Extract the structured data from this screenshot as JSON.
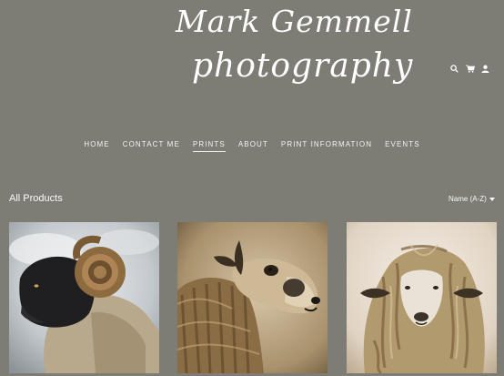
{
  "header": {
    "logo_line1": "Mark Gemmell",
    "logo_line2": "photography",
    "icons": [
      "search-icon",
      "cart-icon",
      "user-icon"
    ]
  },
  "nav": {
    "items": [
      "HOME",
      "CONTACT ME",
      "PRINTS",
      "ABOUT",
      "PRINT INFORMATION",
      "EVENTS"
    ],
    "active": "PRINTS"
  },
  "main": {
    "title": "All Products",
    "sort_label": "Name (A-Z)"
  },
  "colors": {
    "background": "#7d7d76",
    "text": "#ffffff"
  }
}
